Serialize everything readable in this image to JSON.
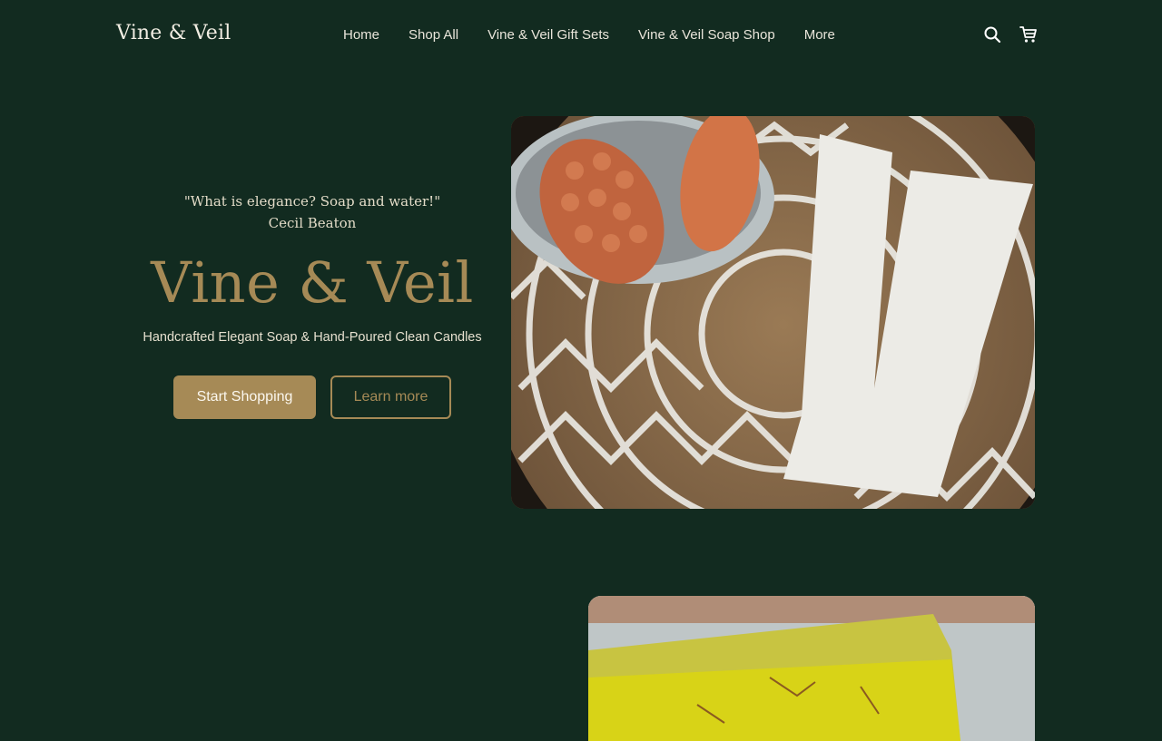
{
  "header": {
    "logo": "Vine & Veil",
    "nav": [
      "Home",
      "Shop All",
      "Vine & Veil Gift Sets",
      "Vine & Veil Soap Shop",
      "More"
    ],
    "icons": [
      "search-icon",
      "cart-icon"
    ]
  },
  "hero": {
    "quote_line1": "\"What is elegance? Soap and water!\"",
    "quote_line2": "Cecil Beaton",
    "title": "Vine & Veil",
    "tagline": "Handcrafted Elegant Soap & Hand-Poured Clean Candles",
    "primary_button": "Start Shopping",
    "secondary_button": "Learn more"
  },
  "colors": {
    "background": "#122b20",
    "accent": "#a68a56",
    "text": "#e8e2d2"
  }
}
